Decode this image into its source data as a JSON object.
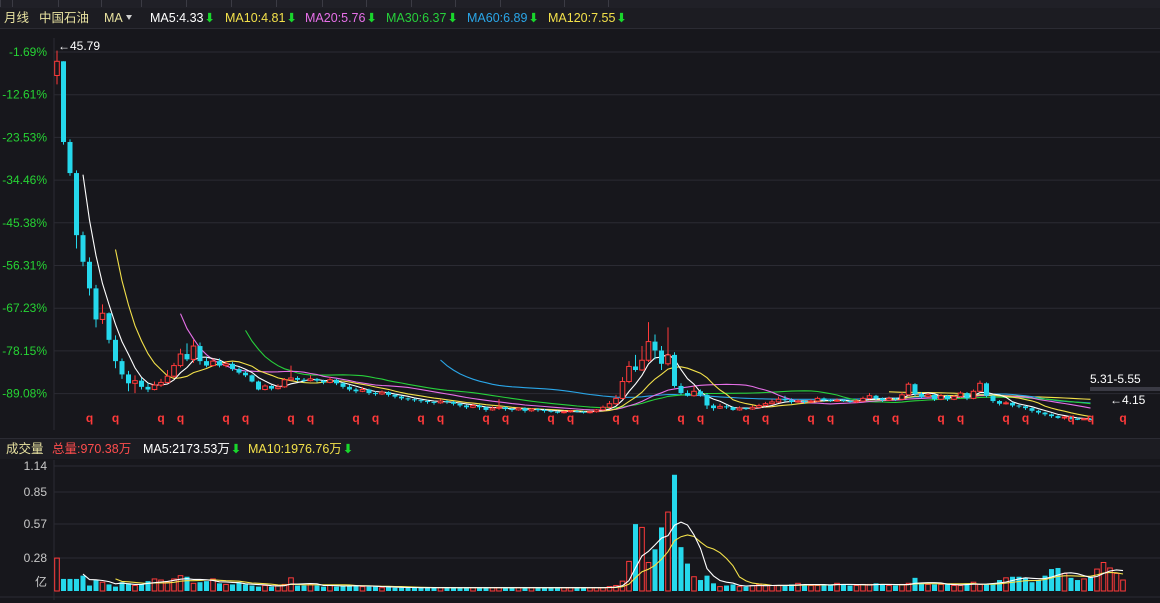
{
  "header": {
    "period": "月线",
    "stock_name": "中国石油",
    "indicator_menu": "MA",
    "ma_items": [
      {
        "label": "MA5:4.33",
        "color": "#ffffff"
      },
      {
        "label": "MA10:4.81",
        "color": "#f3e14a"
      },
      {
        "label": "MA20:5.76",
        "color": "#e770e9"
      },
      {
        "label": "MA30:6.37",
        "color": "#27d03b"
      },
      {
        "label": "MA60:6.89",
        "color": "#2aa6e8"
      },
      {
        "label": "MA120:7.55",
        "color": "#f3e14a"
      }
    ],
    "down_arrow": "⬇"
  },
  "volume_header": {
    "title": "成交量",
    "total": "总量:970.38万",
    "ma5": "MA5:2173.53万",
    "ma10": "MA10:1976.76万"
  },
  "colors": {
    "up": "#ff3a3a",
    "down": "#25d8ec",
    "grid": "#2b2b33",
    "axis_label": "#26d434",
    "vol_axis": "#c8c8c8",
    "bg": "#17171c"
  },
  "chart_data": [
    {
      "type": "candlestick",
      "title": "中国石油 月线",
      "y_axis_labels": [
        "-1.69%",
        "-12.61%",
        "-23.53%",
        "-34.46%",
        "-45.38%",
        "-56.31%",
        "-67.23%",
        "-78.15%",
        "-89.08%"
      ],
      "ylim": [
        3.6,
        47.0
      ],
      "annotations": {
        "high": "45.79",
        "low": "4.15",
        "last_range": "5.31-5.55"
      },
      "event_marker": "q",
      "event_indices": [
        5,
        9,
        16,
        19,
        26,
        29,
        36,
        39,
        46,
        49,
        56,
        59,
        66,
        69,
        76,
        79,
        86,
        89,
        96,
        99,
        106,
        109,
        116,
        119,
        126,
        129,
        136,
        139,
        146,
        149,
        156,
        159,
        164
      ],
      "candles": [
        [
          43.0,
          44.6,
          45.8,
          42.0
        ],
        [
          44.6,
          35.5,
          44.6,
          35.2
        ],
        [
          35.5,
          32.0,
          35.8,
          31.7
        ],
        [
          32.0,
          25.0,
          32.3,
          23.5
        ],
        [
          25.0,
          22.0,
          25.4,
          21.5
        ],
        [
          22.0,
          19.0,
          22.5,
          18.2
        ],
        [
          19.0,
          15.5,
          19.4,
          14.6
        ],
        [
          15.5,
          16.2,
          17.2,
          15.0
        ],
        [
          16.2,
          13.2,
          16.3,
          12.8
        ],
        [
          13.2,
          10.8,
          13.7,
          10.0
        ],
        [
          10.8,
          9.3,
          11.1,
          8.8
        ],
        [
          9.3,
          8.3,
          9.7,
          7.4
        ],
        [
          8.3,
          8.6,
          9.2,
          7.2
        ],
        [
          8.6,
          7.9,
          8.9,
          7.6
        ],
        [
          7.9,
          7.6,
          8.3,
          7.3
        ],
        [
          7.6,
          8.1,
          8.5,
          7.5
        ],
        [
          8.1,
          8.4,
          8.8,
          7.9
        ],
        [
          8.4,
          9.1,
          9.8,
          8.3
        ],
        [
          9.1,
          10.3,
          10.6,
          8.9
        ],
        [
          10.3,
          11.6,
          12.2,
          10.1
        ],
        [
          11.6,
          11.0,
          12.8,
          10.8
        ],
        [
          11.0,
          12.5,
          13.2,
          10.6
        ],
        [
          12.5,
          10.8,
          12.9,
          10.4
        ],
        [
          10.8,
          10.3,
          11.2,
          10.1
        ],
        [
          10.3,
          10.8,
          11.1,
          10.2
        ],
        [
          10.8,
          10.3,
          11.1,
          10.1
        ],
        [
          10.3,
          10.5,
          10.8,
          10.1
        ],
        [
          10.5,
          9.9,
          10.7,
          9.7
        ],
        [
          9.9,
          9.5,
          10.1,
          9.3
        ],
        [
          9.5,
          9.2,
          9.7,
          9.0
        ],
        [
          9.2,
          8.5,
          9.3,
          8.4
        ],
        [
          8.5,
          7.6,
          8.6,
          7.5
        ],
        [
          7.6,
          8.0,
          8.2,
          7.5
        ],
        [
          8.0,
          7.7,
          8.1,
          7.5
        ],
        [
          7.7,
          7.9,
          8.2,
          7.6
        ],
        [
          7.9,
          8.7,
          8.9,
          7.8
        ],
        [
          8.7,
          8.9,
          10.3,
          8.6
        ],
        [
          8.9,
          8.7,
          9.1,
          8.5
        ],
        [
          8.7,
          8.6,
          8.9,
          8.4
        ],
        [
          8.6,
          8.8,
          9.2,
          8.5
        ],
        [
          8.8,
          8.6,
          8.9,
          8.4
        ],
        [
          8.6,
          8.4,
          8.7,
          8.2
        ],
        [
          8.4,
          8.7,
          9.0,
          8.3
        ],
        [
          8.7,
          8.3,
          8.8,
          8.1
        ],
        [
          8.3,
          7.9,
          8.4,
          7.7
        ],
        [
          7.9,
          7.6,
          8.1,
          7.4
        ],
        [
          7.6,
          7.4,
          7.8,
          7.2
        ],
        [
          7.4,
          7.6,
          7.9,
          7.3
        ],
        [
          7.6,
          7.2,
          7.7,
          7.0
        ],
        [
          7.2,
          7.1,
          7.4,
          6.9
        ],
        [
          7.1,
          7.3,
          7.5,
          7.0
        ],
        [
          7.3,
          7.0,
          7.4,
          6.8
        ],
        [
          7.0,
          6.8,
          7.1,
          6.6
        ],
        [
          6.8,
          6.6,
          6.9,
          6.4
        ],
        [
          6.6,
          6.5,
          6.7,
          6.3
        ],
        [
          6.5,
          6.4,
          6.6,
          6.2
        ],
        [
          6.4,
          6.3,
          6.5,
          6.1
        ],
        [
          6.3,
          6.2,
          6.4,
          6.0
        ],
        [
          6.2,
          6.1,
          6.3,
          5.9
        ],
        [
          6.1,
          6.3,
          6.5,
          6.0
        ],
        [
          6.3,
          6.2,
          6.4,
          6.0
        ],
        [
          6.2,
          6.0,
          6.3,
          5.8
        ],
        [
          6.0,
          5.8,
          6.1,
          5.6
        ],
        [
          5.8,
          5.6,
          5.9,
          5.4
        ],
        [
          5.6,
          5.8,
          6.0,
          5.5
        ],
        [
          5.8,
          5.6,
          5.9,
          5.3
        ],
        [
          5.6,
          5.3,
          5.7,
          5.1
        ],
        [
          5.3,
          5.5,
          5.7,
          5.2
        ],
        [
          5.5,
          5.6,
          6.5,
          5.3
        ],
        [
          5.6,
          5.4,
          5.7,
          5.2
        ],
        [
          5.4,
          5.3,
          5.5,
          5.1
        ],
        [
          5.3,
          5.5,
          5.6,
          5.2
        ],
        [
          5.5,
          5.2,
          5.6,
          5.0
        ],
        [
          5.2,
          5.4,
          5.5,
          5.1
        ],
        [
          5.4,
          5.3,
          5.5,
          5.1
        ],
        [
          5.3,
          5.2,
          5.4,
          5.0
        ],
        [
          5.2,
          5.1,
          5.3,
          5.0
        ],
        [
          5.1,
          5.0,
          5.2,
          4.9
        ],
        [
          5.0,
          5.1,
          5.2,
          4.9
        ],
        [
          5.1,
          5.2,
          5.3,
          5.0
        ],
        [
          5.2,
          5.1,
          5.3,
          5.0
        ],
        [
          5.1,
          5.0,
          5.2,
          4.9
        ],
        [
          5.0,
          5.1,
          5.2,
          4.9
        ],
        [
          5.1,
          5.3,
          5.4,
          5.0
        ],
        [
          5.3,
          5.6,
          5.8,
          5.2
        ],
        [
          5.6,
          6.0,
          6.3,
          5.5
        ],
        [
          6.0,
          6.6,
          7.0,
          5.9
        ],
        [
          6.6,
          8.5,
          9.0,
          6.5
        ],
        [
          8.5,
          10.2,
          10.8,
          8.3
        ],
        [
          10.2,
          9.8,
          11.5,
          9.6
        ],
        [
          9.8,
          10.9,
          12.5,
          9.7
        ],
        [
          10.9,
          13.0,
          15.2,
          10.7
        ],
        [
          13.0,
          12.0,
          13.8,
          11.0
        ],
        [
          12.0,
          10.5,
          12.5,
          9.8
        ],
        [
          10.5,
          11.5,
          14.6,
          10.3
        ],
        [
          11.5,
          8.0,
          11.8,
          7.8
        ],
        [
          8.0,
          7.2,
          8.3,
          7.0
        ],
        [
          7.2,
          6.9,
          7.5,
          6.8
        ],
        [
          6.9,
          7.4,
          8.0,
          6.8
        ],
        [
          7.4,
          7.0,
          7.6,
          6.8
        ],
        [
          7.0,
          5.8,
          7.2,
          5.4
        ],
        [
          5.8,
          5.5,
          6.0,
          5.2
        ],
        [
          5.5,
          5.7,
          6.0,
          5.4
        ],
        [
          5.7,
          5.6,
          5.9,
          5.4
        ],
        [
          5.6,
          5.3,
          5.7,
          5.2
        ],
        [
          5.3,
          5.5,
          5.7,
          5.2
        ],
        [
          5.5,
          5.4,
          5.6,
          5.3
        ],
        [
          5.4,
          5.6,
          5.8,
          5.3
        ],
        [
          5.6,
          5.8,
          6.0,
          5.5
        ],
        [
          5.8,
          6.0,
          6.2,
          5.7
        ],
        [
          6.0,
          6.2,
          6.5,
          5.9
        ],
        [
          6.2,
          6.5,
          6.8,
          6.1
        ],
        [
          6.5,
          6.4,
          6.9,
          6.2
        ],
        [
          6.4,
          6.2,
          6.6,
          6.0
        ],
        [
          6.2,
          6.3,
          6.5,
          6.1
        ],
        [
          6.3,
          6.2,
          6.4,
          6.0
        ],
        [
          6.2,
          6.3,
          6.5,
          6.1
        ],
        [
          6.3,
          6.6,
          6.8,
          6.2
        ],
        [
          6.6,
          6.4,
          6.7,
          6.2
        ],
        [
          6.4,
          6.3,
          6.5,
          6.2
        ],
        [
          6.3,
          6.4,
          6.6,
          6.2
        ],
        [
          6.4,
          6.3,
          6.5,
          6.2
        ],
        [
          6.3,
          6.2,
          6.4,
          6.1
        ],
        [
          6.2,
          6.3,
          6.5,
          6.1
        ],
        [
          6.3,
          6.6,
          6.8,
          6.2
        ],
        [
          6.6,
          6.9,
          7.2,
          6.5
        ],
        [
          6.9,
          6.6,
          7.0,
          6.4
        ],
        [
          6.6,
          6.4,
          6.7,
          6.2
        ],
        [
          6.4,
          6.6,
          6.8,
          6.3
        ],
        [
          6.6,
          6.5,
          6.7,
          6.3
        ],
        [
          6.5,
          7.0,
          7.3,
          6.4
        ],
        [
          7.0,
          8.2,
          8.4,
          6.9
        ],
        [
          8.2,
          7.1,
          8.3,
          6.8
        ],
        [
          7.1,
          6.8,
          7.3,
          6.6
        ],
        [
          6.8,
          7.0,
          7.2,
          6.7
        ],
        [
          7.0,
          6.5,
          7.1,
          6.3
        ],
        [
          6.5,
          6.9,
          7.1,
          6.4
        ],
        [
          6.9,
          6.5,
          7.0,
          6.3
        ],
        [
          6.5,
          6.8,
          7.0,
          6.4
        ],
        [
          6.8,
          7.2,
          7.4,
          6.7
        ],
        [
          7.2,
          6.6,
          7.3,
          6.4
        ],
        [
          6.6,
          7.4,
          7.6,
          6.5
        ],
        [
          7.4,
          8.3,
          8.6,
          7.3
        ],
        [
          8.3,
          6.9,
          8.4,
          6.7
        ],
        [
          6.9,
          6.3,
          7.0,
          6.1
        ],
        [
          6.3,
          6.0,
          6.4,
          5.8
        ],
        [
          6.0,
          6.1,
          6.3,
          5.9
        ],
        [
          6.1,
          5.8,
          6.2,
          5.6
        ],
        [
          5.8,
          5.7,
          5.9,
          5.5
        ],
        [
          5.7,
          5.5,
          5.8,
          5.3
        ],
        [
          5.5,
          5.2,
          5.6,
          5.0
        ],
        [
          5.2,
          5.0,
          5.3,
          4.8
        ],
        [
          5.0,
          4.8,
          5.1,
          4.6
        ],
        [
          4.8,
          4.6,
          4.9,
          4.4
        ],
        [
          4.6,
          4.4,
          4.7,
          4.3
        ],
        [
          4.4,
          4.5,
          4.6,
          4.2
        ],
        [
          4.5,
          4.3,
          4.6,
          4.2
        ],
        [
          4.3,
          4.2,
          4.4,
          4.15
        ],
        [
          4.2,
          4.3,
          4.4,
          4.15
        ],
        [
          4.3,
          4.15,
          4.35,
          4.15
        ]
      ]
    },
    {
      "type": "bar",
      "title": "成交量",
      "y_axis_labels": [
        "1.14",
        "0.85",
        "0.57",
        "0.28",
        "亿"
      ],
      "ylim": [
        0,
        1.14
      ],
      "values": [
        0.3,
        0.11,
        0.11,
        0.11,
        0.14,
        0.05,
        0.1,
        0.08,
        0.06,
        0.04,
        0.08,
        0.07,
        0.05,
        0.06,
        0.09,
        0.11,
        0.1,
        0.08,
        0.11,
        0.14,
        0.13,
        0.07,
        0.08,
        0.09,
        0.11,
        0.07,
        0.06,
        0.06,
        0.08,
        0.06,
        0.05,
        0.04,
        0.05,
        0.04,
        0.05,
        0.06,
        0.12,
        0.05,
        0.05,
        0.06,
        0.05,
        0.04,
        0.05,
        0.04,
        0.05,
        0.05,
        0.05,
        0.04,
        0.04,
        0.04,
        0.03,
        0.04,
        0.03,
        0.03,
        0.03,
        0.03,
        0.03,
        0.03,
        0.03,
        0.03,
        0.03,
        0.03,
        0.03,
        0.03,
        0.03,
        0.03,
        0.03,
        0.03,
        0.03,
        0.03,
        0.03,
        0.03,
        0.03,
        0.03,
        0.03,
        0.03,
        0.03,
        0.03,
        0.03,
        0.03,
        0.03,
        0.03,
        0.03,
        0.03,
        0.03,
        0.04,
        0.05,
        0.09,
        0.27,
        0.61,
        0.58,
        0.26,
        0.38,
        0.58,
        0.72,
        1.06,
        0.4,
        0.25,
        0.13,
        0.1,
        0.14,
        0.07,
        0.04,
        0.05,
        0.06,
        0.04,
        0.04,
        0.05,
        0.06,
        0.05,
        0.05,
        0.05,
        0.05,
        0.06,
        0.07,
        0.06,
        0.05,
        0.05,
        0.06,
        0.06,
        0.07,
        0.06,
        0.05,
        0.05,
        0.06,
        0.06,
        0.07,
        0.06,
        0.05,
        0.05,
        0.06,
        0.07,
        0.12,
        0.07,
        0.06,
        0.06,
        0.06,
        0.06,
        0.05,
        0.05,
        0.07,
        0.08,
        0.06,
        0.06,
        0.07,
        0.1,
        0.12,
        0.13,
        0.13,
        0.12,
        0.08,
        0.1,
        0.14,
        0.2,
        0.21,
        0.16,
        0.12,
        0.1,
        0.11,
        0.13,
        0.2,
        0.26,
        0.21,
        0.16,
        0.1
      ],
      "series": [
        {
          "name": "MA5"
        },
        {
          "name": "MA10"
        }
      ]
    }
  ]
}
